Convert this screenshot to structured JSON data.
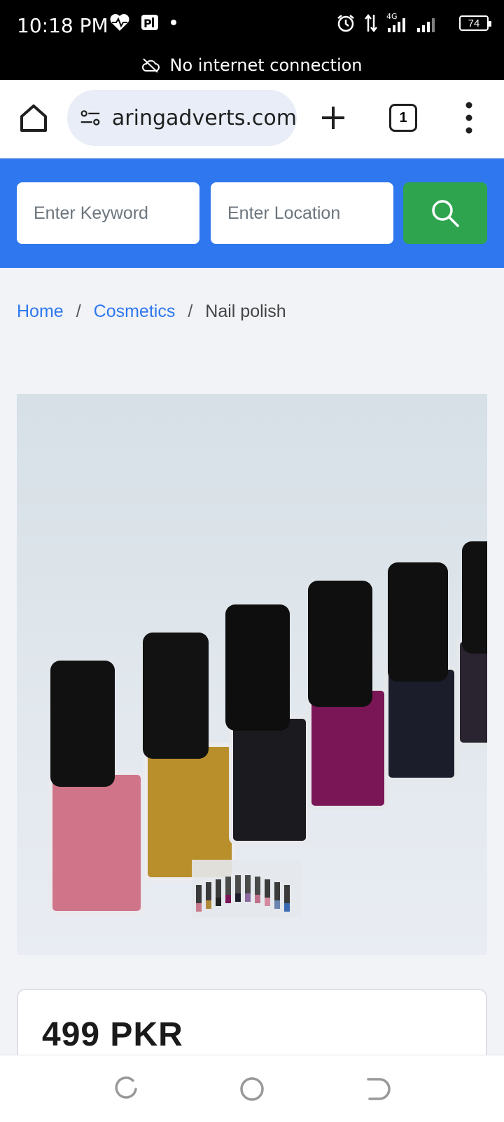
{
  "status_bar": {
    "time": "10:18 PM",
    "network": "4G",
    "battery": "74",
    "icons": [
      "heart-icon",
      "parking-app-icon",
      "dot-icon",
      "alarm-icon",
      "data-arrows-icon",
      "signal-icon",
      "battery-icon"
    ]
  },
  "connectivity_banner": {
    "text": "No internet connection",
    "icon": "cloud-off-icon"
  },
  "browser": {
    "url": "aringadverts.com",
    "tab_count": "1",
    "icons": [
      "home-icon",
      "site-info-icon",
      "new-tab-icon",
      "tab-switcher-icon",
      "overflow-menu-icon"
    ]
  },
  "search": {
    "keyword_placeholder": "Enter Keyword",
    "location_placeholder": "Enter Location",
    "button_icon": "search-icon"
  },
  "breadcrumb": {
    "home": "Home",
    "category": "Cosmetics",
    "current": "Nail polish",
    "separator": "/"
  },
  "product": {
    "image_subject": "nail-polish-bottles",
    "thumbnail_subject": "nail-polish-bottles-thumbnail",
    "price": "499 PKR"
  },
  "nav_bar": {
    "icons": [
      "recent-apps-icon",
      "home-circle-icon",
      "back-icon"
    ]
  },
  "colors": {
    "brand_blue": "#2f77ee",
    "search_green": "#2ea44f"
  }
}
